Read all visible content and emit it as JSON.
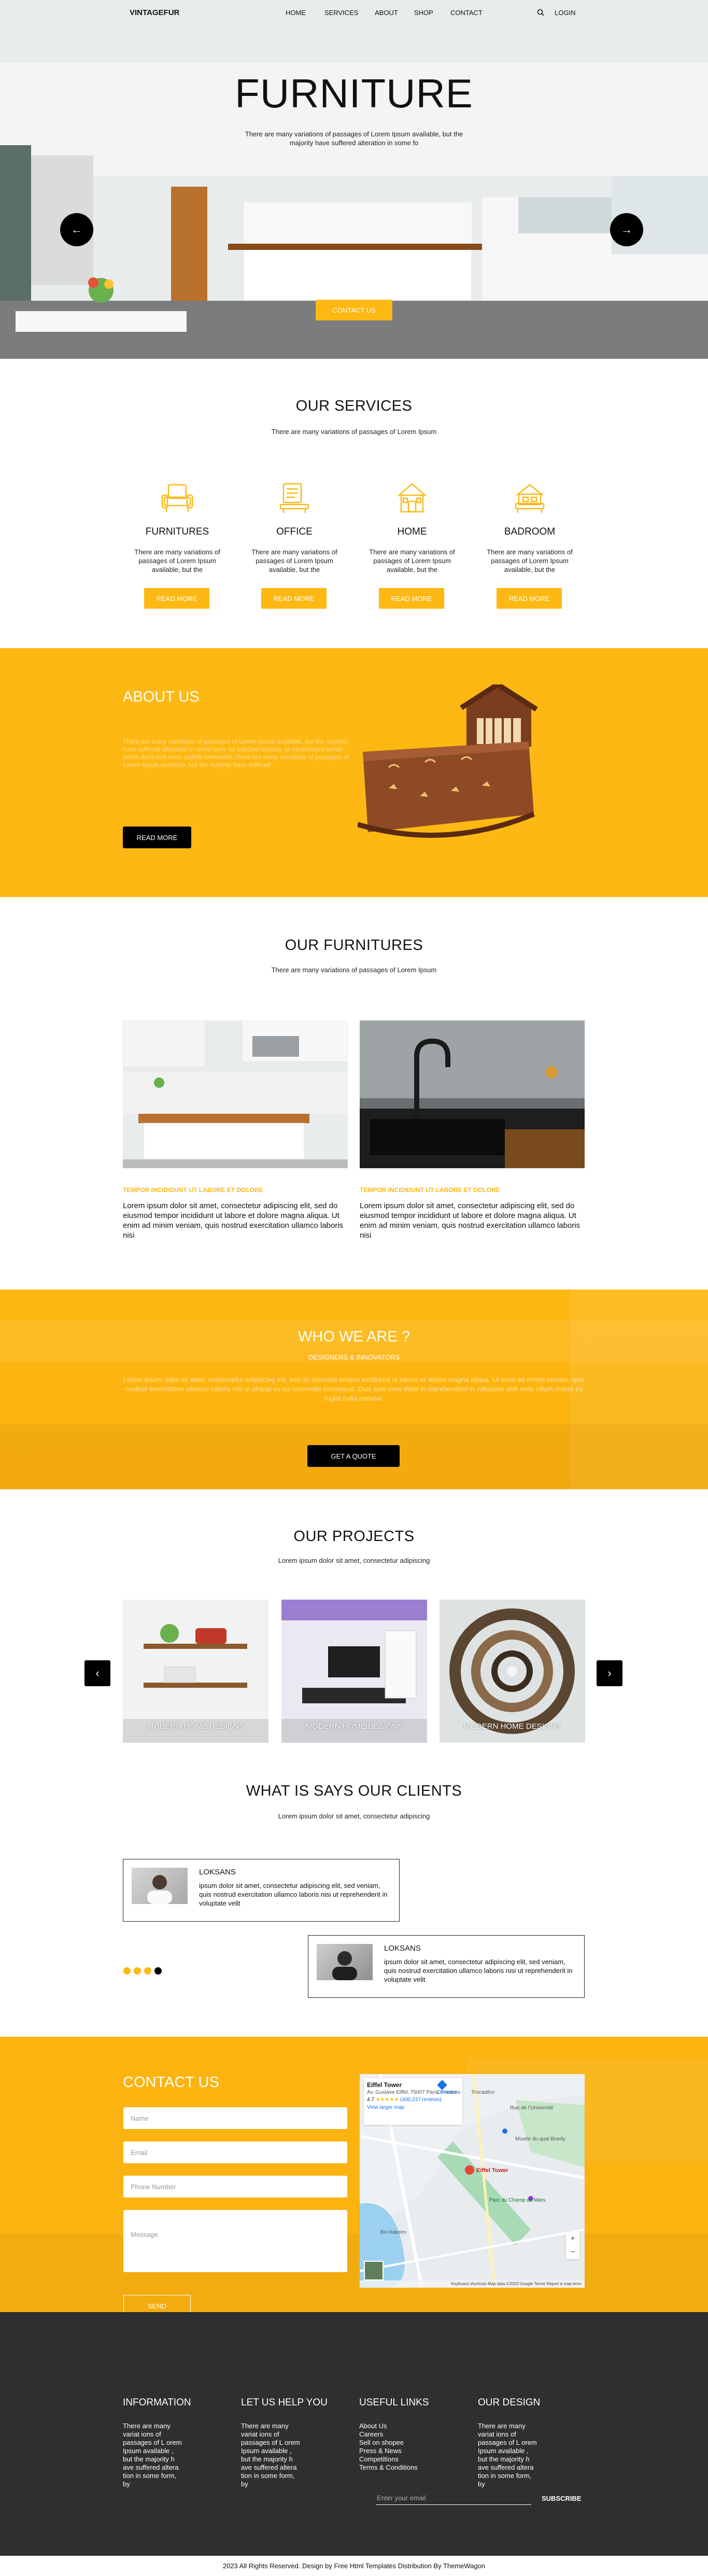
{
  "header": {
    "logo": "VINTAGEFUR",
    "nav": [
      "HOME",
      "SERVICES",
      "ABOUT",
      "SHOP",
      "CONTACT"
    ],
    "login": "LOGIN"
  },
  "hero": {
    "title": "FURNITURE",
    "text": "There are many variations of passages of Lorem Ipsum available, but the majority have suffered alteration in some fo",
    "button": "CONTACT US",
    "prev": "←",
    "next": "→"
  },
  "services": {
    "title": "OUR SERVICES",
    "subtitle": "There are many variations of passages of Lorem Ipsum",
    "items": [
      {
        "title": "FURNITURES",
        "text": "There are many variations of passages of Lorem Ipsum available, but the",
        "button": "READ MORE"
      },
      {
        "title": "OFFICE",
        "text": "There are many variations of passages of Lorem Ipsum available, but the",
        "button": "READ MORE"
      },
      {
        "title": "HOME",
        "text": "There are many variations of passages of Lorem Ipsum available, but the",
        "button": "READ MORE"
      },
      {
        "title": "BADROOM",
        "text": "There are many variations of passages of Lorem Ipsum available, but the",
        "button": "READ MORE"
      }
    ]
  },
  "about": {
    "title": "ABOUT US",
    "text": "There are many variations of passages of Lorem Ipsum available, but the majority have suffered alteration in some form, by injected humour, or randomised words which don't look even slightly believable.There are many variations of passages of Lorem Ipsum available, but the majority have suffered",
    "button": "READ MORE"
  },
  "furnitures": {
    "title": "OUR FURNITURES",
    "subtitle": "There are many variations of passages of Lorem Ipsum",
    "cards": [
      {
        "title": "TEMPOR INCIDIDUNT UT LABORE ET DOLORE",
        "text": "Lorem ipsum dolor sit amet, consectetur adipiscing elit, sed do eiusmod tempor incididunt ut labore et dolore magna aliqua. Ut enim ad minim veniam, quis nostrud exercitation ullamco laboris nisi"
      },
      {
        "title": "TEMPOR INCIDIDUNT UT LABORE ET DOLORE",
        "text": "Lorem ipsum dolor sit amet, consectetur adipiscing elit, sed do eiusmod tempor incididunt ut labore et dolore magna aliqua. Ut enim ad minim veniam, quis nostrud exercitation ullamco laboris nisi"
      }
    ]
  },
  "who": {
    "title": "WHO WE ARE ?",
    "subtitle": "DESIGNERS & INNOVATORS",
    "text": "Lorem ipsum dolor sit amet, consectetur adipiscing elit, sed do eiusmod tempor incididunt ut labore et dolore magna aliqua. Ut enim ad minim veniam, quis nostrud exercitation ullamco laboris nisi ut aliquip ex ea commodo consequat. Duis aute irure dolor in reprehenderit in voluptate velit esse cillum dolore eu fugiat nulla pariatur.",
    "button": "GET A QUOTE"
  },
  "projects": {
    "title": "OUR PROJECTS",
    "subtitle": "Lorem ipsum dolor sit amet, consectetur adipiscing",
    "items": [
      "MODERN HOME DESIGNS",
      "MODERN HOME DESIGNS",
      "MODERN HOME DESIGNS"
    ],
    "prev": "‹",
    "next": "›"
  },
  "clients": {
    "title": "WHAT IS SAYS OUR CLIENTS",
    "subtitle": "Lorem ipsum dolor sit amet, consectetur adipiscing",
    "items": [
      {
        "name": "LOKSANS",
        "text": "ipsum dolor sit amet, consectetur adipiscing elit, sed veniam, quis nostrud exercitation ullamco laboris nisi ut reprehenderit in voluptate velit"
      },
      {
        "name": "LOKSANS",
        "text": "ipsum dolor sit amet, consectetur adipiscing elit, sed veniam, quis nostrud exercitation ullamco laboris nisi ut reprehenderit in voluptate velit"
      }
    ]
  },
  "contact": {
    "title": "CONTACT US",
    "fields": [
      "Name",
      "Email",
      "Phone Number"
    ],
    "message": "Message",
    "button": "SEND"
  },
  "map": {
    "place": "Eiffel Tower",
    "address": "Av. Gustave Eiffel, 75007 Paris, France",
    "rating": "4.7",
    "reviews": "(400,237 reviews)",
    "link": "View larger map",
    "directions": "Directions",
    "labels": [
      "Trocadéro",
      "Parc du Champ de Mars",
      "Eiffel Tower",
      "Musée du quai Branly",
      "Bir-Hakeim",
      "Rue de l'Université"
    ],
    "footer": "Keyboard shortcuts  Map data ©2023 Google  Terms  Report a map error"
  },
  "footer": {
    "columns": [
      {
        "title": "INFORMATION",
        "text": "There are many variat ions of passages of L orem Ipsum available , but the majority h ave suffered altera tion in some form, by"
      },
      {
        "title": "LET US HELP YOU",
        "text": "There are many variat ions of passages of L orem Ipsum available , but the majority h ave suffered altera tion in some form, by"
      },
      {
        "title": "USEFUL LINKS",
        "links": [
          "About Us",
          "Careers",
          "Sell on shopee",
          "Press & News",
          "Competitions",
          "Terms & Conditions"
        ]
      },
      {
        "title": "OUR DESIGN",
        "text": "There are many variat ions of passages of L orem Ipsum available , but the majority h ave suffered altera tion in some form, by"
      }
    ],
    "email_placeholder": "Enter your email",
    "subscribe": "SUBSCRIBE",
    "copyright": "2023 All Rights Reserved. Design by Free Html Templates Distribution By ThemeWagon"
  },
  "colors": {
    "accent": "#fdb813",
    "dark": "#2f2f2f"
  }
}
